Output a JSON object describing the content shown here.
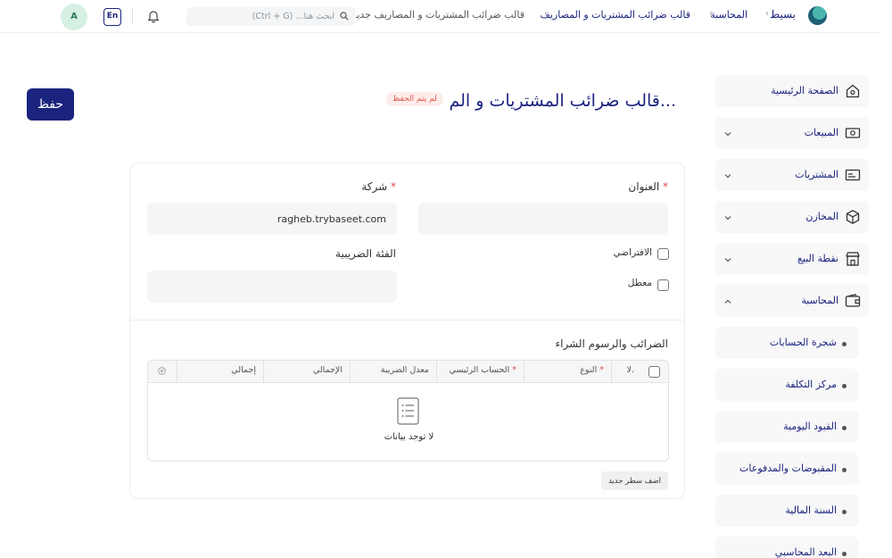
{
  "navbar": {
    "brand": "بسيط",
    "breadcrumbs": [
      "المحاسبة",
      "قالب ضرائب المشتريات و المصاريف",
      "قالب ضرائب المشتريات و المصاريف جديد"
    ],
    "search_placeholder": "ابحث هنا... (Ctrl + G)",
    "language": "En",
    "avatar_initial": "A"
  },
  "page": {
    "title": "قالب ضرائب المشتريات و الم...",
    "status_badge": "لم يتم الحفظ",
    "save_label": "حفظ"
  },
  "sidebar": {
    "items": [
      {
        "label": "الصفحة الرئيسية",
        "icon": "home-icon",
        "expandable": false
      },
      {
        "label": "المبيعات",
        "icon": "cash-icon",
        "expandable": true
      },
      {
        "label": "المشتريات",
        "icon": "card-icon",
        "expandable": true
      },
      {
        "label": "المخازن",
        "icon": "box-icon",
        "expandable": true
      },
      {
        "label": "نقطة البيع",
        "icon": "store-icon",
        "expandable": true
      },
      {
        "label": "المحاسبة",
        "icon": "wallet-icon",
        "expandable": true,
        "expanded": true
      }
    ],
    "subitems": [
      "شجرة الحسابات",
      "مركز التكلفة",
      "القيود اليومية",
      "المقبوضات والمدفوعات",
      "السنة المالية",
      "البعد المحاسبي"
    ]
  },
  "form": {
    "title_label": "العنوان",
    "title_value": "",
    "company_label": "شركة",
    "company_value": "ragheb.trybaseet.com",
    "default_label": "الافتراضي",
    "default_checked": false,
    "disabled_label": "معطل",
    "disabled_checked": false,
    "tax_category_label": "الفئة الضريبية",
    "tax_category_value": ""
  },
  "taxes_table": {
    "section_title": "الضرائب والرسوم الشراء",
    "columns": [
      "لا.",
      "النوع",
      "الحساب الرئيسي",
      "معدل الضريبة",
      "الإجمالي",
      "إجمالي"
    ],
    "empty_text": "لا توجد بيانات",
    "add_row_label": "اضف سطر جديد"
  },
  "colors": {
    "primary": "#1a237e",
    "required": "#e24c4c",
    "badge_bg": "#fdeceb",
    "badge_text": "#e2574c",
    "field_bg": "#f4f5f6"
  }
}
